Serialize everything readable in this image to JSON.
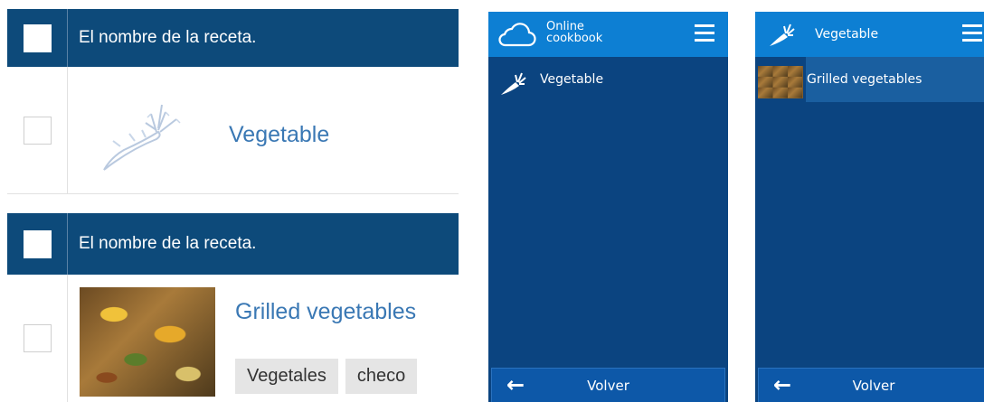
{
  "table_panel_1": {
    "header": "El nombre de la receta.",
    "row": {
      "title": "Vegetable"
    }
  },
  "table_panel_2": {
    "header": "El nombre de la receta.",
    "row": {
      "title": "Grilled vegetables",
      "tags": [
        "Vegetales",
        "checo"
      ]
    }
  },
  "phone_1": {
    "app_title_line1": "Online",
    "app_title_line2": "cookbook",
    "items": [
      {
        "label": "Vegetable",
        "icon": "carrot-icon"
      }
    ],
    "footer": {
      "back_label": "Volver",
      "arrow": "←"
    }
  },
  "phone_2": {
    "header_title": "Vegetable",
    "items": [
      {
        "label": "Grilled vegetables",
        "icon": "food-thumbnail"
      }
    ],
    "footer": {
      "back_label": "Volver",
      "arrow": "←"
    }
  },
  "colors": {
    "table_header": "#0d4a7a",
    "link": "#3a78b4",
    "phone_bg": "#0b4480",
    "phone_topbar": "#0d7fd3",
    "phone_footer": "#0d58a8"
  }
}
